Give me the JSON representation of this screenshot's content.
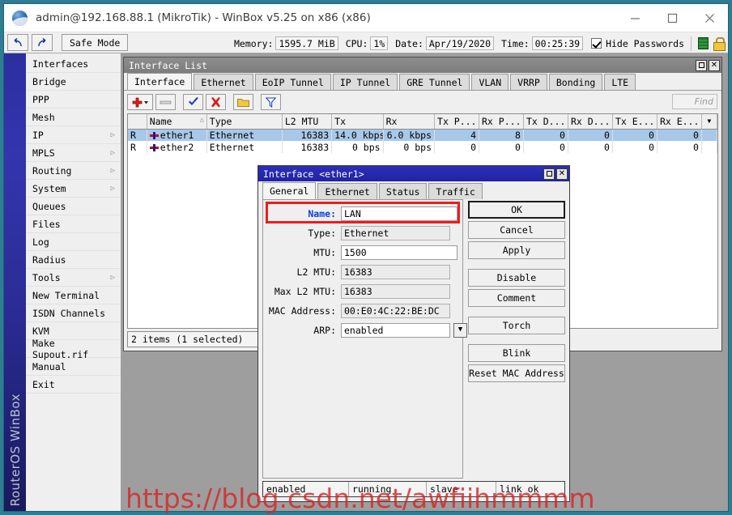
{
  "window": {
    "title": "admin@192.168.88.1 (MikroTik) - WinBox v5.25 on x86 (x86)",
    "icon": "winbox-globe-icon",
    "minimize_label": "minimize-icon",
    "maximize_label": "maximize-icon",
    "close_label": "close-icon"
  },
  "toolbar": {
    "undo_label": "undo-icon",
    "redo_label": "redo-icon",
    "safe_mode_label": "Safe Mode",
    "memory_label": "Memory:",
    "memory_value": "1595.7 MiB",
    "cpu_label": "CPU:",
    "cpu_value": "1%",
    "date_label": "Date:",
    "date_value": "Apr/19/2020",
    "time_label": "Time:",
    "time_value": "00:25:39",
    "hide_passwords_label": "Hide Passwords",
    "hide_passwords_checked": true
  },
  "sidebar": {
    "brand_text": "RouterOS WinBox",
    "items": [
      {
        "label": "Interfaces",
        "has_submenu": false
      },
      {
        "label": "Bridge",
        "has_submenu": false
      },
      {
        "label": "PPP",
        "has_submenu": false
      },
      {
        "label": "Mesh",
        "has_submenu": false
      },
      {
        "label": "IP",
        "has_submenu": true
      },
      {
        "label": "MPLS",
        "has_submenu": true
      },
      {
        "label": "Routing",
        "has_submenu": true
      },
      {
        "label": "System",
        "has_submenu": true
      },
      {
        "label": "Queues",
        "has_submenu": false
      },
      {
        "label": "Files",
        "has_submenu": false
      },
      {
        "label": "Log",
        "has_submenu": false
      },
      {
        "label": "Radius",
        "has_submenu": false
      },
      {
        "label": "Tools",
        "has_submenu": true
      },
      {
        "label": "New Terminal",
        "has_submenu": false
      },
      {
        "label": "ISDN Channels",
        "has_submenu": false
      },
      {
        "label": "KVM",
        "has_submenu": false
      },
      {
        "label": "Make Supout.rif",
        "has_submenu": false
      },
      {
        "label": "Manual",
        "has_submenu": false
      },
      {
        "label": "Exit",
        "has_submenu": false
      }
    ]
  },
  "interface_list": {
    "title": "Interface List",
    "restore_label": "restore-icon",
    "close_label": "close-icon",
    "tabs": [
      {
        "label": "Interface",
        "active": true
      },
      {
        "label": "Ethernet",
        "active": false
      },
      {
        "label": "EoIP Tunnel",
        "active": false
      },
      {
        "label": "IP Tunnel",
        "active": false
      },
      {
        "label": "GRE Tunnel",
        "active": false
      },
      {
        "label": "VLAN",
        "active": false
      },
      {
        "label": "VRRP",
        "active": false
      },
      {
        "label": "Bonding",
        "active": false
      },
      {
        "label": "LTE",
        "active": false
      }
    ],
    "toolbar_buttons": [
      {
        "name": "add-button",
        "glyph": "+"
      },
      {
        "name": "remove-button",
        "glyph": "−"
      },
      {
        "name": "enable-button",
        "glyph": "✔"
      },
      {
        "name": "disable-button",
        "glyph": "✖"
      },
      {
        "name": "comment-button",
        "glyph": "▣"
      },
      {
        "name": "filter-button",
        "glyph": "▽"
      }
    ],
    "find_placeholder": "Find",
    "columns": [
      "",
      "Name",
      "Type",
      "L2 MTU",
      "Tx",
      "Rx",
      "Tx P...",
      "Rx P...",
      "Tx D...",
      "Rx D...",
      "Tx E...",
      "Rx E..."
    ],
    "rows": [
      {
        "flag": "R",
        "name": "ether1",
        "type": "Ethernet",
        "l2mtu": "16383",
        "tx": "14.0 kbps",
        "rx": "6.0 kbps",
        "tx_p": "4",
        "rx_p": "8",
        "tx_d": "0",
        "rx_d": "0",
        "tx_e": "0",
        "rx_e": "0",
        "selected": true
      },
      {
        "flag": "R",
        "name": "ether2",
        "type": "Ethernet",
        "l2mtu": "16383",
        "tx": "0 bps",
        "rx": "0 bps",
        "tx_p": "0",
        "rx_p": "0",
        "tx_d": "0",
        "rx_d": "0",
        "tx_e": "0",
        "rx_e": "0",
        "selected": false
      }
    ],
    "status": "2 items (1 selected)"
  },
  "interface_dialog": {
    "title": "Interface <ether1>",
    "restore_label": "restore-icon",
    "close_label": "close-icon",
    "tabs": [
      {
        "label": "General",
        "active": true
      },
      {
        "label": "Ethernet",
        "active": false
      },
      {
        "label": "Status",
        "active": false
      },
      {
        "label": "Traffic",
        "active": false
      }
    ],
    "fields": [
      {
        "label": "Name:",
        "value": "LAN",
        "highlighted": true,
        "readonly": false,
        "dropdown": false
      },
      {
        "label": "Type:",
        "value": "Ethernet",
        "highlighted": false,
        "readonly": true,
        "dropdown": false
      },
      {
        "label": "MTU:",
        "value": "1500",
        "highlighted": false,
        "readonly": false,
        "dropdown": false
      },
      {
        "label": "L2 MTU:",
        "value": "16383",
        "highlighted": false,
        "readonly": true,
        "dropdown": false
      },
      {
        "label": "Max L2 MTU:",
        "value": "16383",
        "highlighted": false,
        "readonly": true,
        "dropdown": false
      },
      {
        "label": "MAC Address:",
        "value": "00:E0:4C:22:BE:DC",
        "highlighted": false,
        "readonly": true,
        "dropdown": false
      },
      {
        "label": "ARP:",
        "value": "enabled",
        "highlighted": false,
        "readonly": false,
        "dropdown": true
      }
    ],
    "buttons": [
      {
        "label": "OK",
        "primary": true,
        "gap_above": false
      },
      {
        "label": "Cancel",
        "primary": false,
        "gap_above": false
      },
      {
        "label": "Apply",
        "primary": false,
        "gap_above": false
      },
      {
        "label": "Disable",
        "primary": false,
        "gap_above": true
      },
      {
        "label": "Comment",
        "primary": false,
        "gap_above": false
      },
      {
        "label": "Torch",
        "primary": false,
        "gap_above": true
      },
      {
        "label": "Blink",
        "primary": false,
        "gap_above": true
      },
      {
        "label": "Reset MAC Address",
        "primary": false,
        "gap_above": false
      }
    ],
    "status_cells": [
      "enabled",
      "running",
      "slave",
      "link ok"
    ]
  },
  "watermark": {
    "text": "https://blog.csdn.net/awfiihmmmm",
    "color": "#d62323"
  },
  "colors": {
    "desktop_bg": "#9e9e9e",
    "outer_bg": "#2e7d92",
    "accent_blue": "#0a3fd8",
    "dialog_title": "#2b2fb8",
    "selection": "#a8c8ea",
    "highlight_red": "#ee1c1c"
  }
}
